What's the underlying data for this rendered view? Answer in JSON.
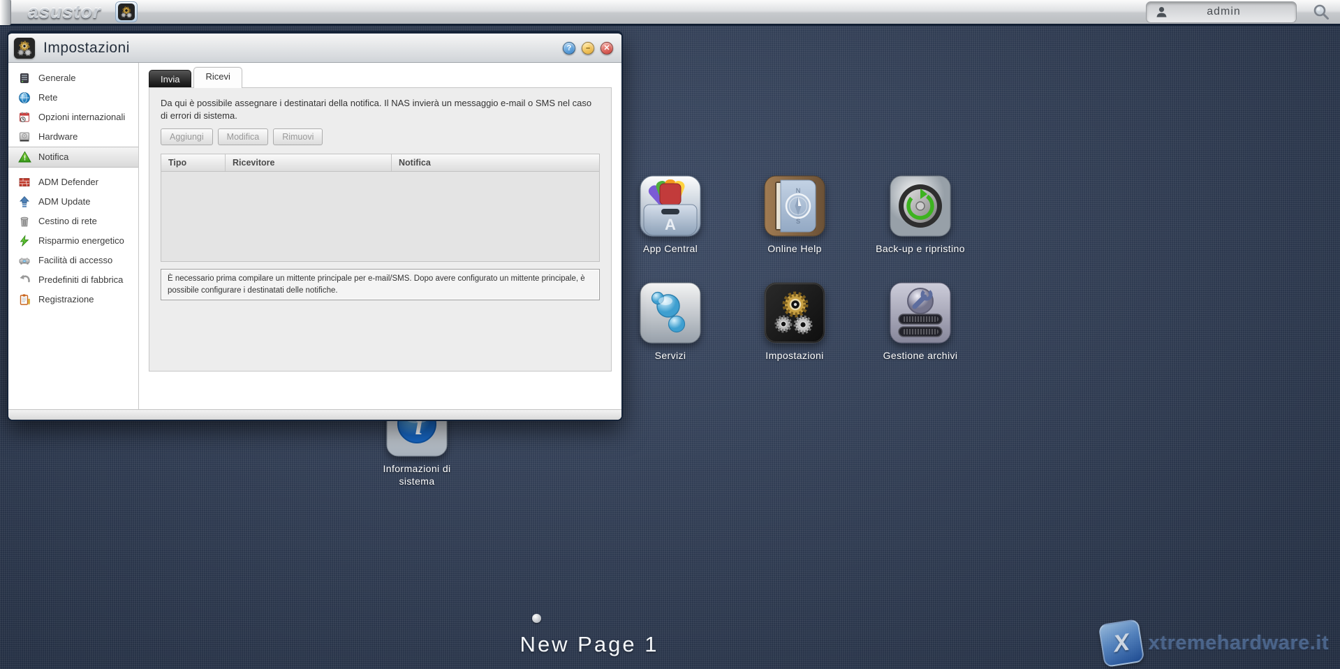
{
  "topbar": {
    "logo": "asustor",
    "taskbar_app_icon": "gears-app-icon",
    "user": "admin",
    "search_icon": "search-icon",
    "user_icon": "person-icon"
  },
  "window": {
    "title": "Impostazioni",
    "title_icon": "gears-icon",
    "controls": {
      "help": "?",
      "minimize": "–",
      "close": "✕"
    },
    "sidebar": {
      "items": [
        {
          "label": "Generale",
          "icon": "server-icon",
          "selected": false
        },
        {
          "label": "Rete",
          "icon": "network-globe-icon",
          "selected": false
        },
        {
          "label": "Opzioni internazionali",
          "icon": "calendar-clock-icon",
          "selected": false
        },
        {
          "label": "Hardware",
          "icon": "harddrive-icon",
          "selected": false
        },
        {
          "label": "Notifica",
          "icon": "alert-triangle-icon",
          "selected": true
        },
        {
          "label": "ADM Defender",
          "icon": "firewall-icon",
          "selected": false
        },
        {
          "label": "ADM Update",
          "icon": "update-arrow-icon",
          "selected": false
        },
        {
          "label": "Cestino di rete",
          "icon": "trash-icon",
          "selected": false
        },
        {
          "label": "Risparmio energetico",
          "icon": "energy-bolt-icon",
          "selected": false
        },
        {
          "label": "Facilità di accesso",
          "icon": "access-device-icon",
          "selected": false
        },
        {
          "label": "Predefiniti di fabbrica",
          "icon": "reset-arrow-icon",
          "selected": false
        },
        {
          "label": "Registrazione",
          "icon": "clipboard-icon",
          "selected": false
        }
      ]
    },
    "tabs": [
      {
        "label": "Invia",
        "active": false
      },
      {
        "label": "Ricevi",
        "active": true
      }
    ],
    "panel": {
      "description": "Da qui è possibile assegnare i destinatari della notifica. Il NAS invierà un messaggio e-mail o SMS nel caso di errori di sistema.",
      "buttons": [
        "Aggiungi",
        "Modifica",
        "Rimuovi"
      ],
      "buttons_disabled": true,
      "table_headers": [
        "Tipo",
        "Ricevitore",
        "Notifica"
      ],
      "table_rows": [],
      "notice": "È necessario prima compilare un mittente principale per e-mail/SMS. Dopo avere configurato un mittente principale, è possibile configurare i destinatati delle notifiche."
    }
  },
  "desktop": {
    "icons": [
      {
        "label": "App Central",
        "icon": "app-central-icon"
      },
      {
        "label": "Online Help",
        "icon": "online-help-icon"
      },
      {
        "label": "Back-up e ripristino",
        "icon": "backup-restore-icon"
      },
      {
        "label": "Servizi",
        "icon": "services-icon"
      },
      {
        "label": "Impostazioni",
        "icon": "settings-gears-icon"
      },
      {
        "label": "Gestione archivi",
        "icon": "storage-manager-icon"
      },
      {
        "label": "Informazioni di sistema",
        "icon": "system-info-icon"
      }
    ],
    "page_label": "New Page 1",
    "watermark": "xtremehardware.it",
    "watermark_logo": "X"
  },
  "colors": {
    "desktop_bg": "#2e3d58",
    "topbar_border": "#121f33",
    "help_button": "#3f8fd6",
    "minimize_button": "#e8b33c",
    "close_button": "#d9534f",
    "inactive_tab": "#2b2b2b",
    "alert_green": "#2f9414"
  }
}
